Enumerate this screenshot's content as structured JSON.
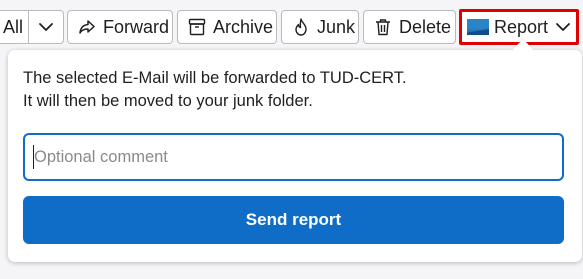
{
  "toolbar": {
    "all_label": "All",
    "forward_label": "Forward",
    "archive_label": "Archive",
    "junk_label": "Junk",
    "delete_label": "Delete",
    "report_label": "Report"
  },
  "report_panel": {
    "message_line1": "The selected E-Mail will be forwarded to TUD-CERT.",
    "message_line2": "It will then be moved to your junk folder.",
    "comment_placeholder": "Optional comment",
    "comment_value": "",
    "send_label": "Send report"
  },
  "colors": {
    "accent": "#0f6cc7",
    "highlight_border": "#e00000"
  },
  "icons": {
    "forward": "forward-arrow-icon",
    "archive": "archive-box-icon",
    "junk": "flame-icon",
    "delete": "trash-icon",
    "report": "report-flag-icon",
    "dropdown": "chevron-down-icon"
  }
}
